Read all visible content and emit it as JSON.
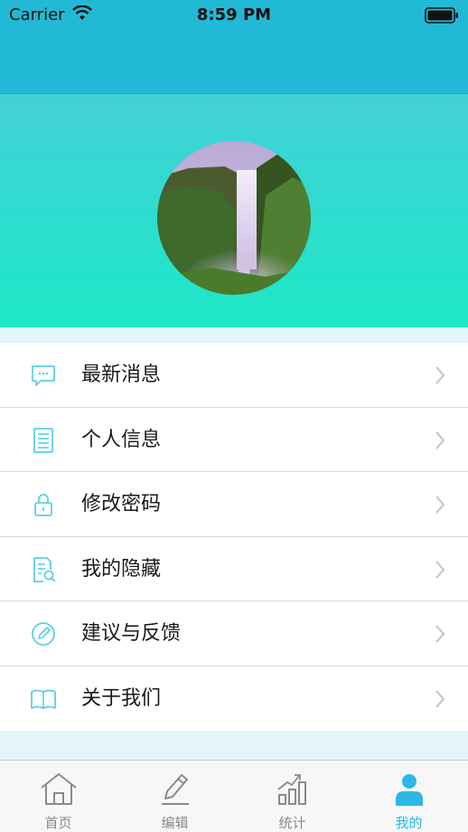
{
  "status_bar": {
    "carrier": "Carrier",
    "time": "8:59 PM"
  },
  "profile": {
    "avatar": "waterfall-avatar"
  },
  "menu": [
    {
      "label": "最新消息",
      "icon": "message-icon"
    },
    {
      "label": "个人信息",
      "icon": "document-icon"
    },
    {
      "label": "修改密码",
      "icon": "lock-icon"
    },
    {
      "label": "我的隐藏",
      "icon": "hidden-file-icon"
    },
    {
      "label": "建议与反馈",
      "icon": "edit-feedback-icon"
    },
    {
      "label": "关于我们",
      "icon": "book-icon"
    }
  ],
  "tab_bar": {
    "tabs": [
      {
        "label": "首页",
        "icon": "home-icon",
        "active": false
      },
      {
        "label": "编辑",
        "icon": "pencil-icon",
        "active": false
      },
      {
        "label": "统计",
        "icon": "chart-icon",
        "active": false
      },
      {
        "label": "我的",
        "icon": "person-icon",
        "active": true
      }
    ],
    "active_color": "#2bb8e6",
    "inactive_color": "#8a8a8a"
  },
  "colors": {
    "nav": "#22b9d6",
    "accent": "#5ccfe6",
    "header_top": "#43d0d8",
    "header_bottom": "#1be8c6"
  }
}
